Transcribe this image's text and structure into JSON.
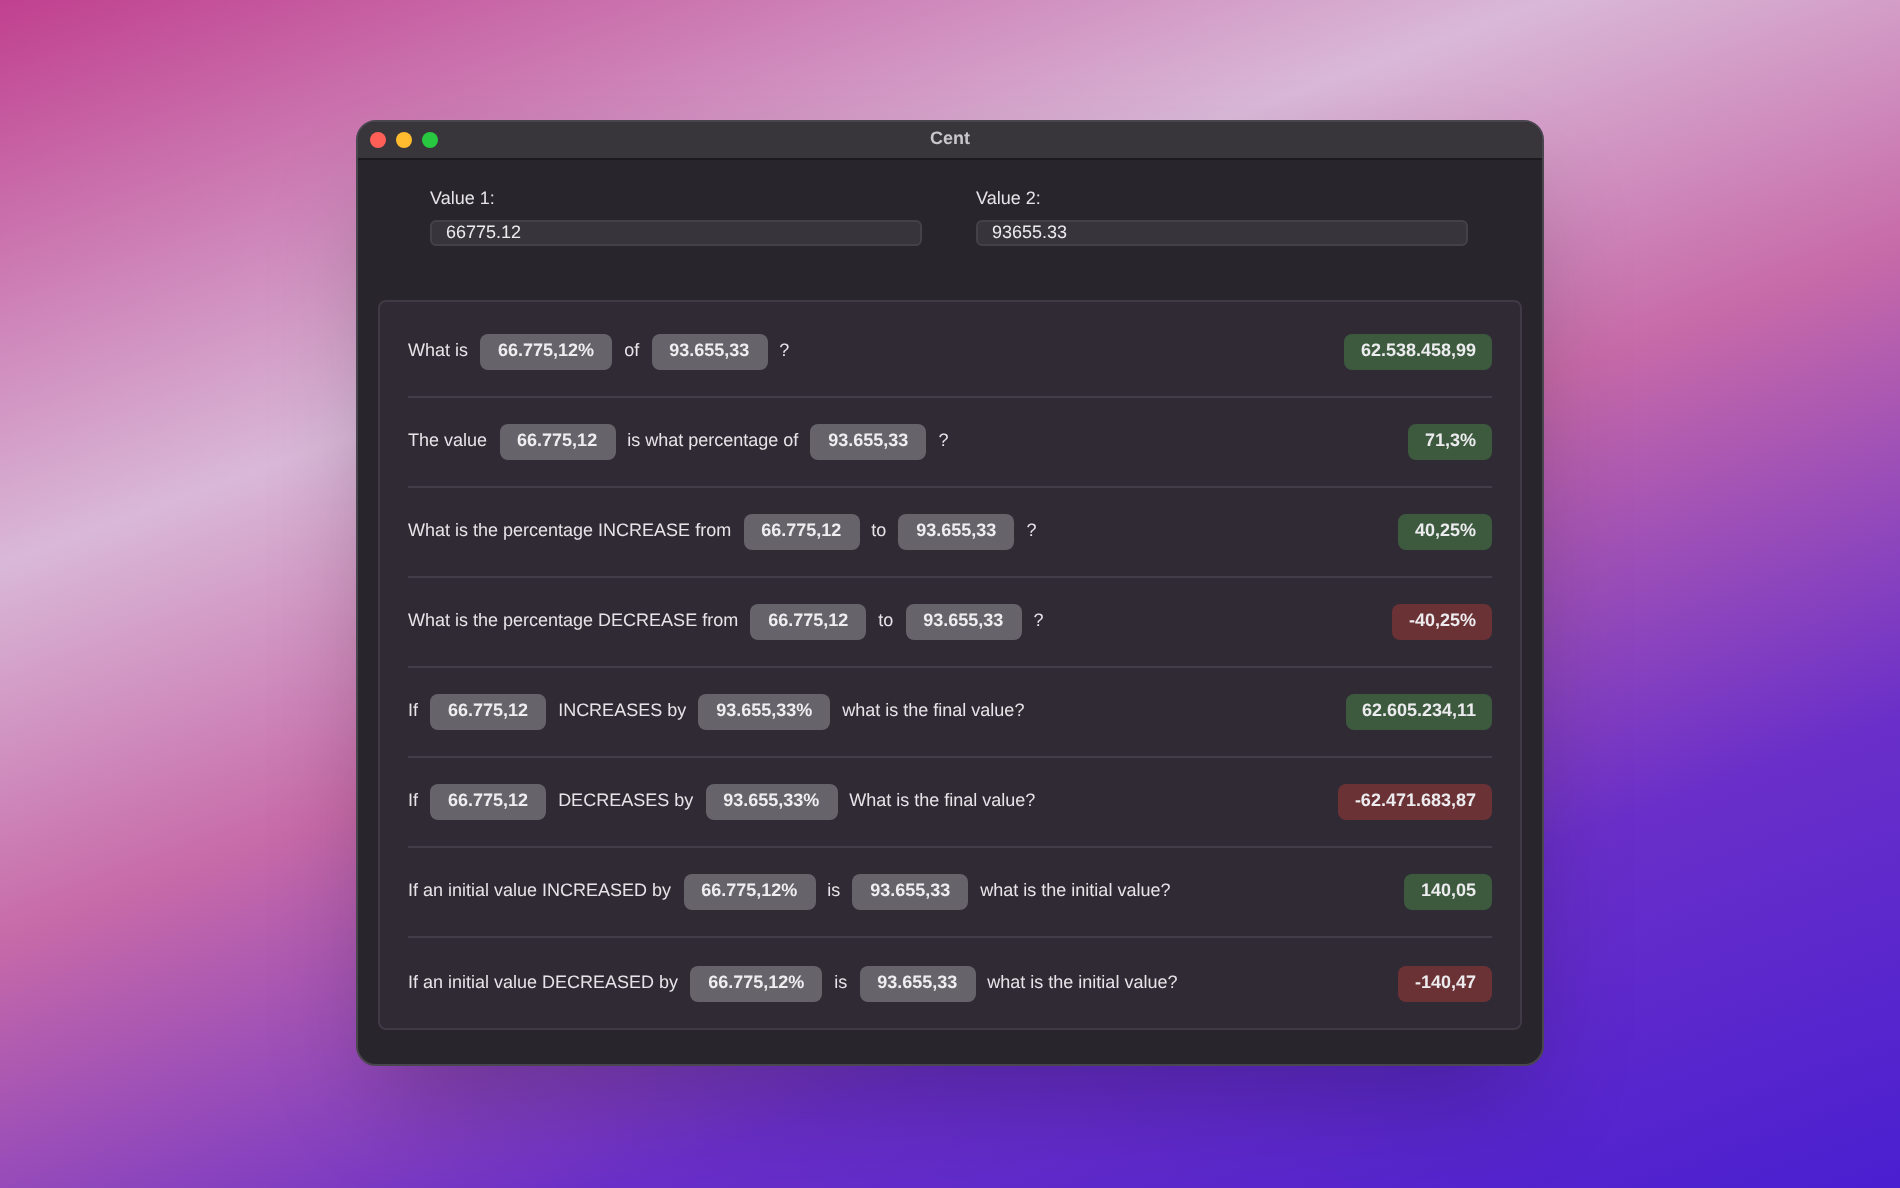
{
  "window": {
    "title": "Cent"
  },
  "inputs": [
    {
      "label": "Value 1:",
      "value": "66775.12"
    },
    {
      "label": "Value 2:",
      "value": "93655.33"
    }
  ],
  "rows": [
    {
      "parts": [
        {
          "kind": "text",
          "text": "What is"
        },
        {
          "kind": "chip",
          "text": "66.775,12%"
        },
        {
          "kind": "text",
          "text": "of"
        },
        {
          "kind": "chip",
          "text": "93.655,33"
        },
        {
          "kind": "text",
          "text": "?"
        }
      ],
      "result": {
        "text": "62.538.458,99",
        "color": "#3d5a3f"
      }
    },
    {
      "parts": [
        {
          "kind": "text",
          "text": "The value"
        },
        {
          "kind": "chip",
          "text": "66.775,12"
        },
        {
          "kind": "text",
          "text": "is what percentage of"
        },
        {
          "kind": "chip",
          "text": "93.655,33"
        },
        {
          "kind": "text",
          "text": "?"
        }
      ],
      "result": {
        "text": "71,3%",
        "color": "#3d5a3f"
      }
    },
    {
      "parts": [
        {
          "kind": "text",
          "text": "What is the percentage INCREASE from"
        },
        {
          "kind": "chip",
          "text": "66.775,12"
        },
        {
          "kind": "text",
          "text": "to"
        },
        {
          "kind": "chip",
          "text": "93.655,33"
        },
        {
          "kind": "text",
          "text": "?"
        }
      ],
      "result": {
        "text": "40,25%",
        "color": "#3d5a3f"
      }
    },
    {
      "parts": [
        {
          "kind": "text",
          "text": "What is the percentage DECREASE from"
        },
        {
          "kind": "chip",
          "text": "66.775,12"
        },
        {
          "kind": "text",
          "text": "to"
        },
        {
          "kind": "chip",
          "text": "93.655,33"
        },
        {
          "kind": "text",
          "text": "?"
        }
      ],
      "result": {
        "text": "-40,25%",
        "color": "#6b3236"
      }
    },
    {
      "parts": [
        {
          "kind": "text",
          "text": "If"
        },
        {
          "kind": "chip",
          "text": "66.775,12"
        },
        {
          "kind": "text",
          "text": "INCREASES by"
        },
        {
          "kind": "chip",
          "text": "93.655,33%"
        },
        {
          "kind": "text",
          "text": "what is the final value?"
        }
      ],
      "result": {
        "text": "62.605.234,11",
        "color": "#3d5a3f"
      }
    },
    {
      "parts": [
        {
          "kind": "text",
          "text": "If"
        },
        {
          "kind": "chip",
          "text": "66.775,12"
        },
        {
          "kind": "text",
          "text": "DECREASES by"
        },
        {
          "kind": "chip",
          "text": "93.655,33%"
        },
        {
          "kind": "text",
          "text": "What is the final value?"
        }
      ],
      "result": {
        "text": "-62.471.683,87",
        "color": "#6b3236"
      }
    },
    {
      "parts": [
        {
          "kind": "text",
          "text": "If an initial value INCREASED by"
        },
        {
          "kind": "chip",
          "text": "66.775,12%"
        },
        {
          "kind": "text",
          "text": "is"
        },
        {
          "kind": "chip",
          "text": "93.655,33"
        },
        {
          "kind": "text",
          "text": "what is the initial value?"
        }
      ],
      "result": {
        "text": "140,05",
        "color": "#3d5a3f"
      }
    },
    {
      "parts": [
        {
          "kind": "text",
          "text": "If an initial value DECREASED by"
        },
        {
          "kind": "chip",
          "text": "66.775,12%"
        },
        {
          "kind": "text",
          "text": "is"
        },
        {
          "kind": "chip",
          "text": "93.655,33"
        },
        {
          "kind": "text",
          "text": "what is the initial value?"
        }
      ],
      "result": {
        "text": "-140,47",
        "color": "#6b3236"
      }
    }
  ]
}
